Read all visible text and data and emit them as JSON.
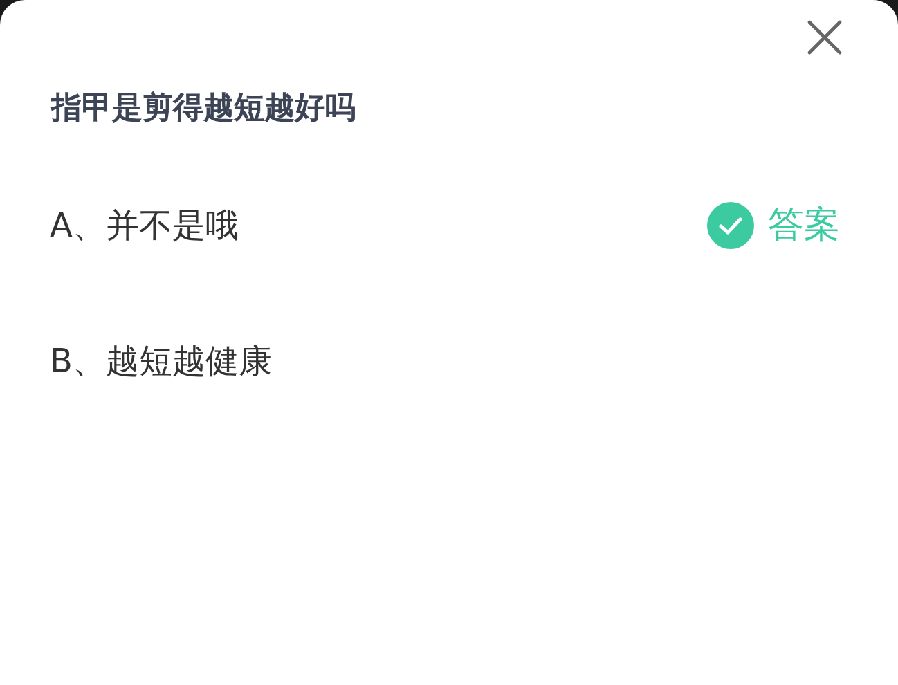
{
  "question": {
    "title": "指甲是剪得越短越好吗"
  },
  "options": [
    {
      "label": "A、并不是哦",
      "correct": true,
      "badge": "答案"
    },
    {
      "label": "B、越短越健康",
      "correct": false
    }
  ]
}
